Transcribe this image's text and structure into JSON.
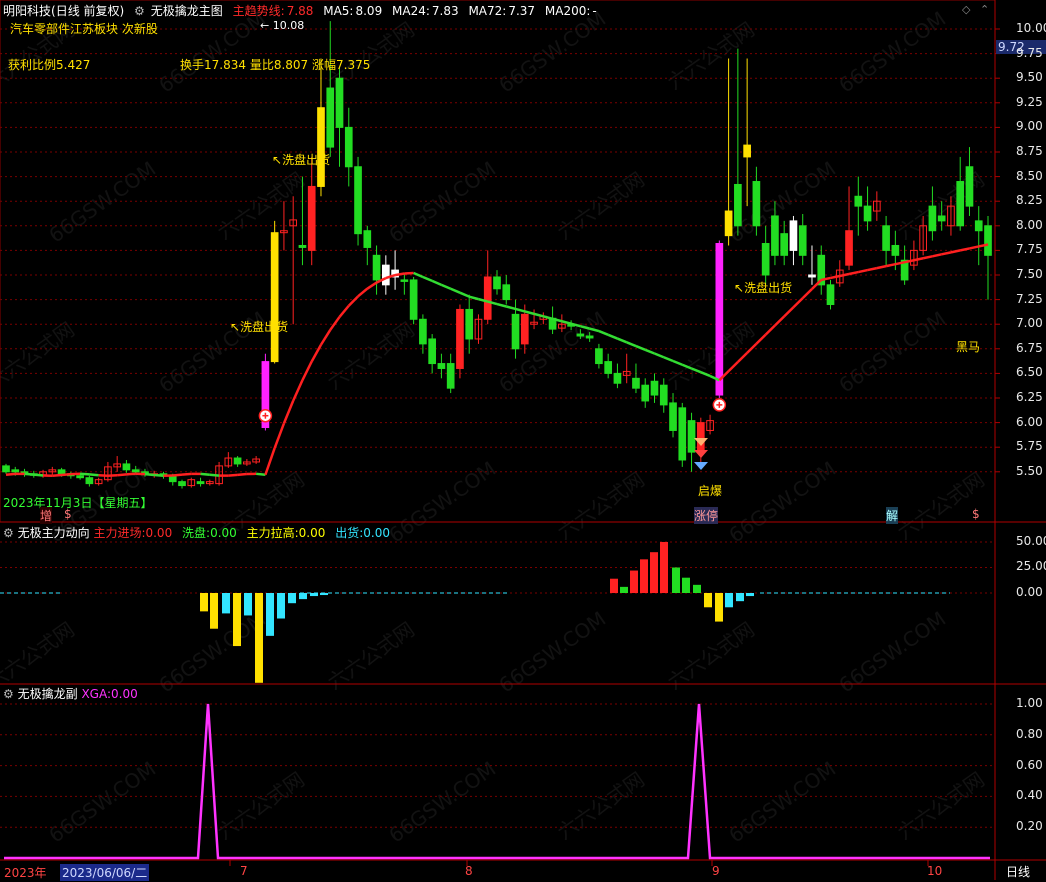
{
  "main_panel": {
    "stock": "明阳科技",
    "period": "(日线 前复权)",
    "indicator_name": "无极擒龙主图",
    "trend_label": "主趋势线:",
    "trend_value": "7.88",
    "ma_items": [
      {
        "label": "MA5:",
        "value": "8.09",
        "color": "#ffffff"
      },
      {
        "label": "MA24:",
        "value": "7.83",
        "color": "#ffffff"
      },
      {
        "label": "MA72:",
        "value": "7.37",
        "color": "#ffffff"
      },
      {
        "label": "MA200:",
        "value": "-",
        "color": "#ffffff"
      }
    ],
    "concepts": "汽车零部件",
    "concept2": "江苏板块",
    "concept3": "次新股",
    "profit_ratio_label": "获利比例",
    "profit_ratio_value": "5.427",
    "turnover": "换手17.834",
    "volume_ratio": "量比8.807",
    "amplitude": "涨幅7.375",
    "high_marker": "10.08",
    "date_label": "2023年11月3日【星期五】",
    "annotations": [
      "洗盘出货",
      "洗盘出货",
      "洗盘出货",
      "启爆",
      "黑马"
    ],
    "bottom_tags": [
      "增",
      "$",
      "涨停",
      "解",
      "$"
    ],
    "current_price": "9.72",
    "y_ticks": [
      "10.00",
      "9.75",
      "9.50",
      "9.25",
      "9.00",
      "8.75",
      "8.50",
      "8.25",
      "8.00",
      "7.75",
      "7.50",
      "7.25",
      "7.00",
      "6.75",
      "6.50",
      "6.25",
      "6.00",
      "5.75",
      "5.50"
    ]
  },
  "sub_panel_1": {
    "name": "无极主力动向",
    "items": [
      {
        "label": "主力进场:",
        "value": "0.00",
        "color": "#ff2a2a"
      },
      {
        "label": "洗盘:",
        "value": "0.00",
        "color": "#33ff33"
      },
      {
        "label": "主力拉高:",
        "value": "0.00",
        "color": "#ffff00"
      },
      {
        "label": "出货:",
        "value": "0.00",
        "color": "#33e5ff"
      }
    ],
    "y_ticks": [
      "50.00",
      "25.00",
      "0.00"
    ]
  },
  "sub_panel_2": {
    "name": "无极擒龙副",
    "item_label": "XGA:",
    "item_value": "0.00",
    "y_ticks": [
      "1.00",
      "0.80",
      "0.60",
      "0.40",
      "0.20"
    ]
  },
  "x_axis": {
    "year": "2023年",
    "cursor_date": "2023/06/06/二",
    "months": [
      "7",
      "8",
      "9",
      "10"
    ],
    "period_button": "日线"
  },
  "watermark": "66GSW.COM",
  "watermark2": "六六公式网",
  "colors": {
    "up": "#ff2222",
    "down": "#22dd22",
    "trend_up": "#ff2020",
    "trend_down": "#33dd33",
    "highlight_yellow": "#ffe000",
    "highlight_magenta": "#ff22ff",
    "grid": "#7a0000",
    "axis_text": "#e8e8e8"
  }
}
